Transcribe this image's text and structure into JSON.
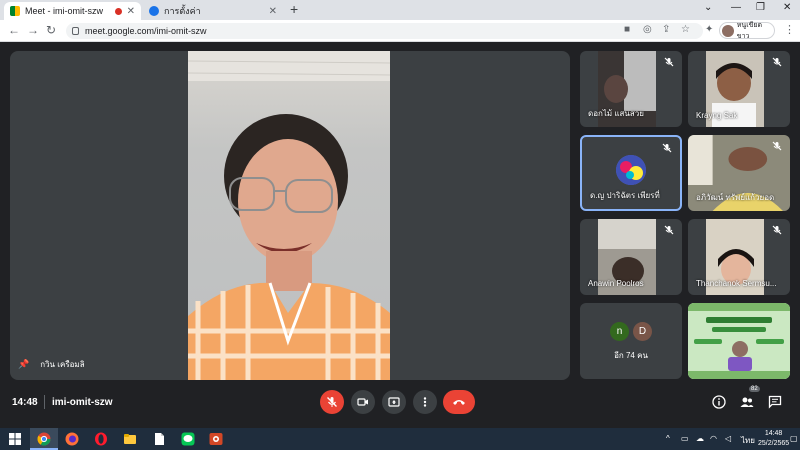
{
  "browser": {
    "tabs": [
      {
        "title": "Meet - imi-omit-szw",
        "active": true
      },
      {
        "title": "การตั้งค่า",
        "active": false
      }
    ],
    "url": "meet.google.com/imi-omit-szw",
    "profile_name": "หนูเขียดขาว"
  },
  "meet": {
    "main_speaker_name": "กวิน เครือมลิ",
    "participants": [
      {
        "name": "ดอกไม้ แสนสวย",
        "muted": true
      },
      {
        "name": "Krayng Sak",
        "muted": true
      },
      {
        "name": "ด.ญ ปาริฉัตร เพียรที่",
        "muted": true,
        "active": true
      },
      {
        "name": "อภิวัฒน์ ทรัพย์แก้วยอด",
        "muted": true
      },
      {
        "name": "Anawin Poolros",
        "muted": true
      },
      {
        "name": "Thanchanok Sermsu...",
        "muted": true
      }
    ],
    "others": {
      "initials": [
        "n",
        "D"
      ],
      "label": "อีก 74 คน"
    },
    "meeting_time": "14:48",
    "meeting_code": "imi-omit-szw",
    "participant_count": "82"
  },
  "taskbar": {
    "lang": "ไทย",
    "time": "14:48",
    "date": "25/2/2565"
  },
  "colors": {
    "background": "#202124",
    "tile": "#3c4043",
    "hangup": "#ea4335",
    "active_border": "#8ab4f8"
  }
}
